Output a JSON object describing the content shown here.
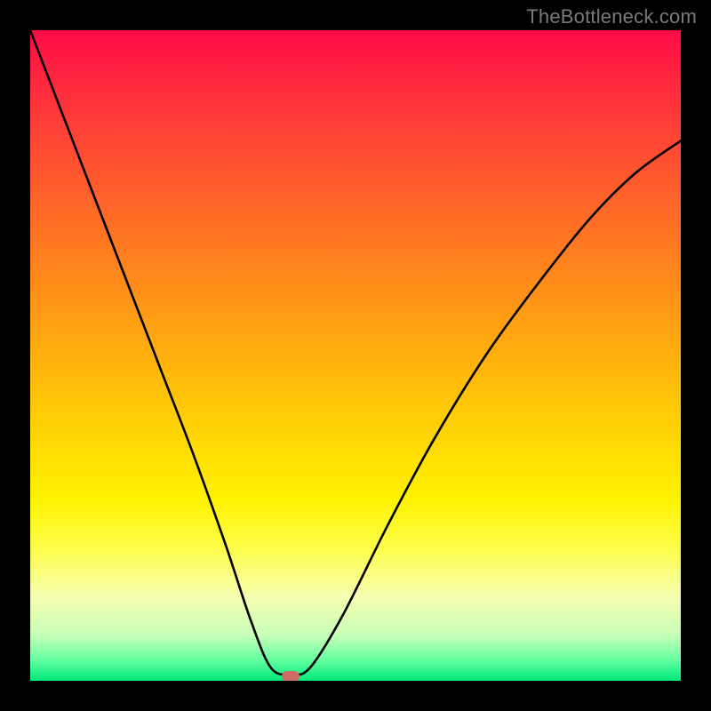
{
  "watermark": "TheBottleneck.com",
  "colors": {
    "frame": "#000000",
    "curve": "#000000",
    "marker": "#cc6d63",
    "gradient_top": "#ff0b46",
    "gradient_bottom": "#00e97a"
  },
  "marker": {
    "x_frac": 0.4,
    "y_frac": 0.993
  },
  "chart_data": {
    "type": "line",
    "title": "",
    "xlabel": "",
    "ylabel": "",
    "xlim": [
      0,
      1
    ],
    "ylim": [
      0,
      1
    ],
    "annotations": [
      "TheBottleneck.com"
    ],
    "series": [
      {
        "name": "curve",
        "x": [
          0.0,
          0.05,
          0.1,
          0.15,
          0.2,
          0.25,
          0.3,
          0.34,
          0.37,
          0.4,
          0.43,
          0.48,
          0.55,
          0.62,
          0.7,
          0.78,
          0.86,
          0.93,
          1.0
        ],
        "y": [
          1.0,
          0.87,
          0.74,
          0.61,
          0.48,
          0.35,
          0.21,
          0.09,
          0.02,
          0.01,
          0.02,
          0.1,
          0.24,
          0.37,
          0.5,
          0.61,
          0.71,
          0.78,
          0.83
        ]
      }
    ],
    "marker_point": {
      "x": 0.4,
      "y": 0.007
    }
  }
}
